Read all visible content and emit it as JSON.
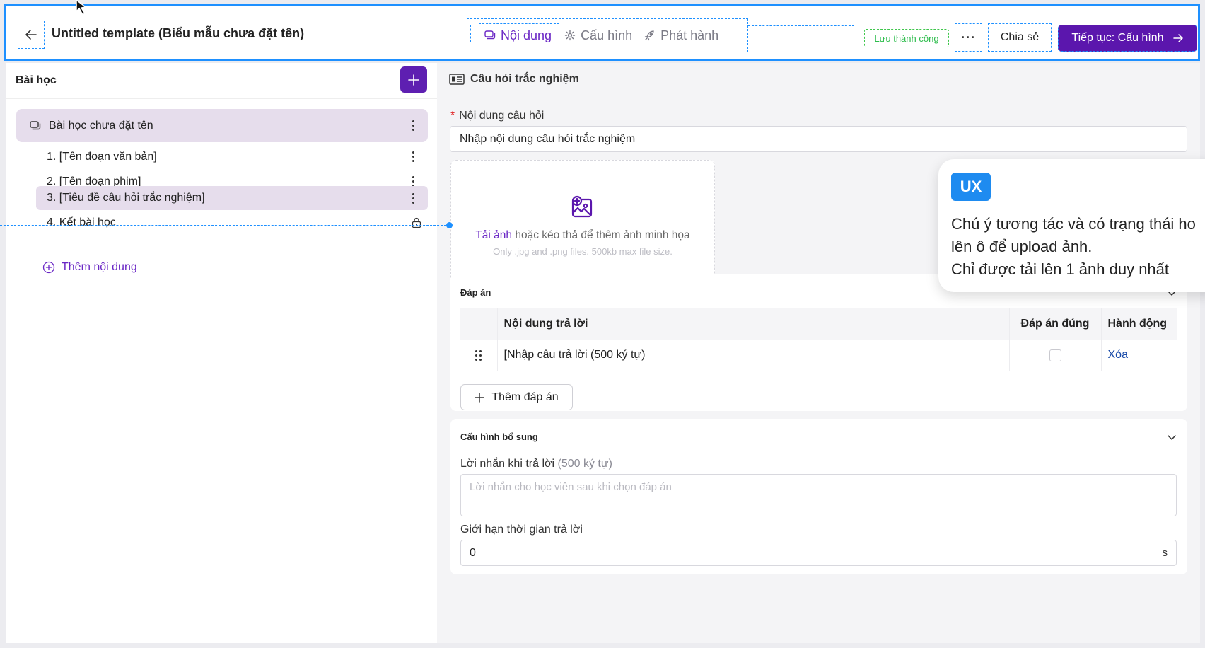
{
  "header": {
    "title": "Untitled template (Biểu mẫu chưa đặt tên)",
    "tabs": [
      {
        "label": "Nội dung"
      },
      {
        "label": "Cấu hình"
      },
      {
        "label": "Phát hành"
      }
    ],
    "save_status": "Lưu thành công",
    "more_label": "···",
    "share_label": "Chia sẻ",
    "continue_label": "Tiếp tục: Cấu hình"
  },
  "sidebar": {
    "title": "Bài học",
    "lesson": "Bài học chưa đặt tên",
    "items": [
      {
        "label": "1. [Tên đoạn văn bản]"
      },
      {
        "label": "2. [Tên đoạn phim]"
      },
      {
        "label": "3. [Tiêu đề câu hỏi trắc nghiệm]"
      },
      {
        "label": "4. Kết bài học"
      }
    ],
    "add_content": "Thêm nội dung"
  },
  "editor": {
    "section_title": "Câu hỏi trắc nghiệm",
    "question_label": "Nội dung câu hỏi",
    "question_value": "Nhập nội dung câu hỏi trắc nghiệm",
    "upload": {
      "link": "Tải ảnh",
      "text": " hoặc kéo thả để thêm ảnh minh họa",
      "hint": "Only .jpg and .png files. 500kb max file size."
    },
    "answers": {
      "title": "Đáp án",
      "columns": [
        "Nội dung trả lời",
        "Đáp án đúng",
        "Hành động"
      ],
      "rows": [
        {
          "text": "[Nhập câu trả lời (500 ký tự)",
          "delete": "Xóa"
        }
      ],
      "add_label": "Thêm đáp án"
    },
    "extra": {
      "title": "Cấu hình bổ sung",
      "message_label": "Lời nhắn khi trả lời",
      "message_hint": "(500 ký tự)",
      "message_placeholder": "Lời nhắn cho học viên sau khi chọn đáp án",
      "time_label": "Giới hạn thời gian trả lời",
      "time_value": "0",
      "time_unit": "s"
    }
  },
  "ux_note": {
    "badge": "UX",
    "lines": [
      "Chú ý tương tác và có trạng thái ho",
      "lên ô để upload ảnh.",
      "Chỉ được tải lên 1 ảnh duy nhất"
    ]
  },
  "colors": {
    "accent": "#5b16ad",
    "annotation": "#1e90ff",
    "success": "#2ebd4d",
    "selected_bg": "#e6ddec"
  }
}
